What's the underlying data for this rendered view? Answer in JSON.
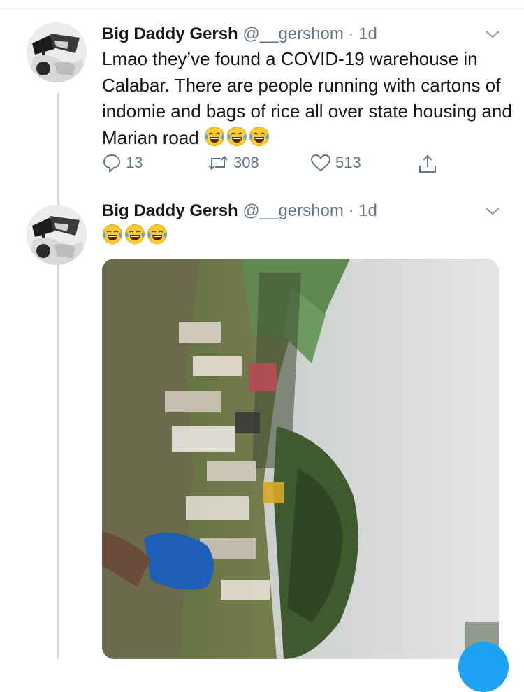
{
  "tweets": [
    {
      "name": "Big Daddy Gersh",
      "handle": "@__gershom",
      "separator": "·",
      "time": "1d",
      "text": "Lmao they’ve found a COVID-19 warehouse in Calabar. There are people running with cartons of indomie and bags of rice all over state housing and Marian road",
      "emoji": [
        "face-with-tears-of-joy",
        "face-with-tears-of-joy",
        "face-with-tears-of-joy"
      ],
      "replies": "13",
      "retweets": "308",
      "likes": "513"
    },
    {
      "name": "Big Daddy Gersh",
      "handle": "@__gershom",
      "separator": "·",
      "time": "1d",
      "emoji": [
        "face-with-tears-of-joy",
        "face-with-tears-of-joy",
        "face-with-tears-of-joy"
      ],
      "media": "video-still"
    }
  ],
  "colors": {
    "text": "#14171a",
    "secondary": "#657786",
    "accent": "#1da1f2",
    "thread": "#cfd9de"
  }
}
